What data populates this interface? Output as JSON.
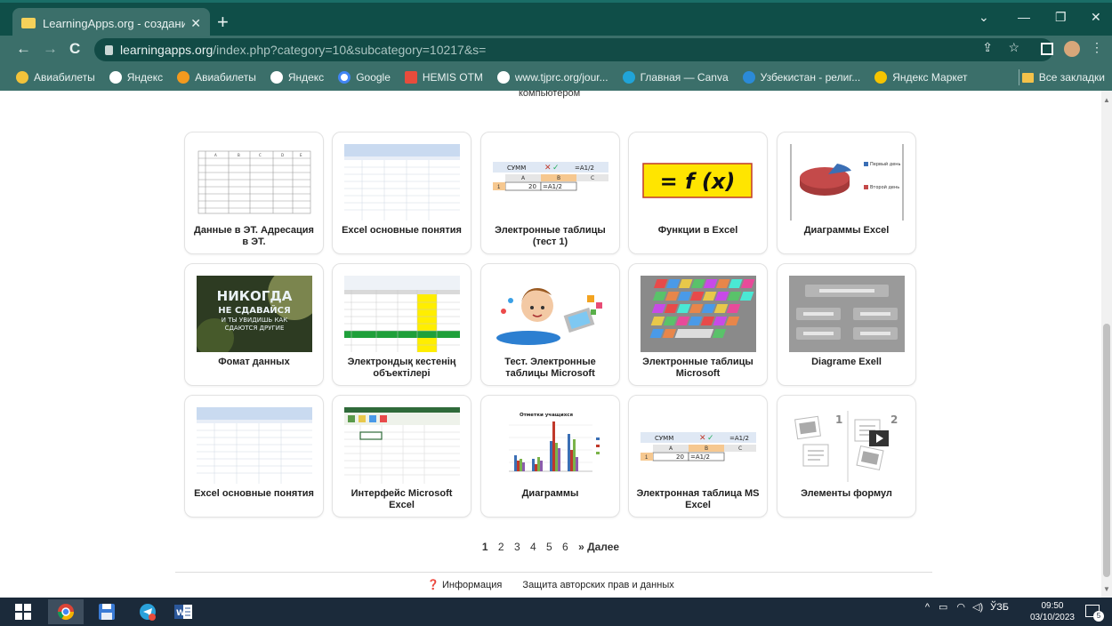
{
  "browser": {
    "tab_title": "LearningApps.org - создание м...",
    "url_host": "learningapps.org",
    "url_path": "/index.php?category=10&subcategory=10217&s=",
    "bookmarks": [
      {
        "label": "Авиабилеты",
        "color": "#f2c33a"
      },
      {
        "label": "Яндекс",
        "color": "#111111"
      },
      {
        "label": "Авиабилеты",
        "color": "#f39a1e"
      },
      {
        "label": "Яндекс",
        "color": "#111111"
      },
      {
        "label": "Google",
        "color": "#4285f4"
      },
      {
        "label": "HEMIS OTM",
        "color": "#e74c3c"
      },
      {
        "label": "www.tjprc.org/jour...",
        "color": "#dddddd"
      },
      {
        "label": "Главная — Canva",
        "color": "#20a4d8"
      },
      {
        "label": "Узбекистан - религ...",
        "color": "#2b8ad8"
      },
      {
        "label": "Яндекс Маркет",
        "color": "#f5c400"
      }
    ],
    "all_bookmarks": "Все закладки"
  },
  "page": {
    "cut_text": "компьютером",
    "cards": [
      {
        "title": "Данные в ЭТ. Адресация в ЭТ.",
        "thumb": "spreadsheet-table"
      },
      {
        "title": "Excel основные понятия",
        "thumb": "excel-window"
      },
      {
        "title": "Электронные таблицы (тест 1)",
        "thumb": "formula-cell",
        "formula": "=A1/2",
        "cell_name": "СУММ",
        "cell_value": "20"
      },
      {
        "title": "Функции в Excel",
        "thumb": "fx-sign",
        "fx": "= f (x)"
      },
      {
        "title": "Диаграммы Excel",
        "thumb": "pie-chart",
        "legend1": "Первый день",
        "legend2": "Второй день"
      },
      {
        "title": "Фомат данных",
        "thumb": "motivation-text",
        "lines": [
          "НИКОГДА",
          "НЕ СДАВАЙСЯ",
          "И ТЫ УВИДИШЬ КАК",
          "СДАЮТСЯ ДРУГИЕ"
        ]
      },
      {
        "title": "Электрондық кестенің объектілері",
        "thumb": "excel-highlight"
      },
      {
        "title": "Тест. Электронные таблицы Microsoft",
        "thumb": "boy-laptop"
      },
      {
        "title": "Электронные таблицы Microsoft",
        "thumb": "keyboard"
      },
      {
        "title": "Diagrame Exell",
        "thumb": "placeholder-app"
      },
      {
        "title": "Excel основные понятия",
        "thumb": "excel-window"
      },
      {
        "title": "Интерфейс Microsoft Excel",
        "thumb": "excel-interface"
      },
      {
        "title": "Диаграммы",
        "thumb": "bar-chart",
        "chart_title": "Отметки учащихся"
      },
      {
        "title": "Электронная таблица MS Excel",
        "thumb": "formula-cell",
        "formula": "=A1/2",
        "cell_name": "СУММ",
        "cell_value": "20"
      },
      {
        "title": "Элементы формул",
        "thumb": "media-placeholder"
      }
    ],
    "pagination": {
      "pages": [
        "1",
        "2",
        "3",
        "4",
        "5",
        "6"
      ],
      "current": "1",
      "next": "» Далее"
    },
    "footer": {
      "info": "❓ Информация",
      "copyright": "Защита авторских прав и данных"
    }
  },
  "taskbar": {
    "lang": "ЎЗБ",
    "time": "09:50",
    "date": "03/10/2023",
    "notif_count": "5"
  }
}
